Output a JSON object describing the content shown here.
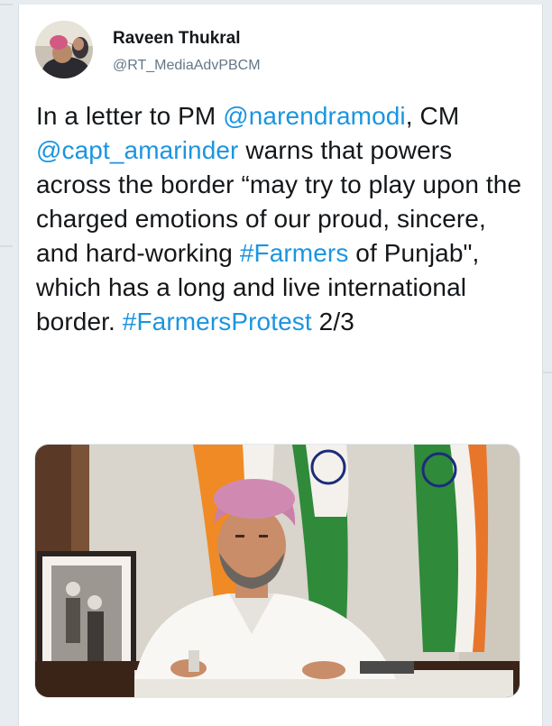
{
  "author": {
    "name": "Raveen Thukral",
    "handle": "@RT_MediaAdvPBCM"
  },
  "tweet": {
    "t1": "In a letter to PM ",
    "mention1": "@narendramodi",
    "t2": ", CM ",
    "mention2": "@capt_amarinder",
    "t3": " warns that powers across the border “may try to play upon the charged emotions of our proud, sincere, and hard-working ",
    "hashtag1": "#Farmers",
    "t4": " of Punjab\", which has a long and live international border.  ",
    "hashtag2": "#FarmersProtest",
    "t5": " 2/3"
  },
  "colors": {
    "link": "#1b95e0",
    "text": "#14171a",
    "secondary": "#657786"
  },
  "media": {
    "icon": "photo-image"
  }
}
